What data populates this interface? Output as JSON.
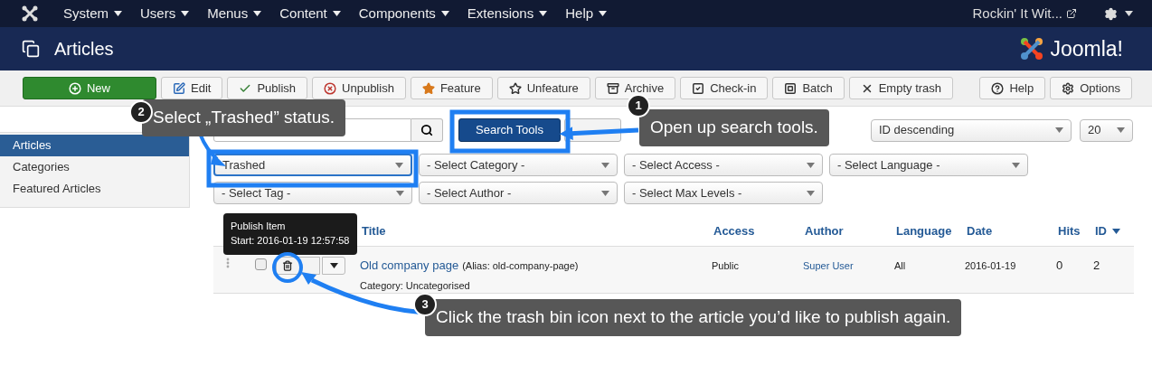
{
  "top_menu": {
    "items": [
      "System",
      "Users",
      "Menus",
      "Content",
      "Components",
      "Extensions",
      "Help"
    ],
    "site_link": "Rockin' It Wit..."
  },
  "header": {
    "title": "Articles",
    "logo_text": "Joomla!"
  },
  "toolbar": {
    "buttons": [
      {
        "label": "New",
        "kind": "new"
      },
      {
        "label": "Edit",
        "kind": "edit"
      },
      {
        "label": "Publish",
        "kind": "publish"
      },
      {
        "label": "Unpublish",
        "kind": "unpublish"
      },
      {
        "label": "Feature",
        "kind": "feature"
      },
      {
        "label": "Unfeature",
        "kind": "unfeature"
      },
      {
        "label": "Archive",
        "kind": "archive"
      },
      {
        "label": "Check-in",
        "kind": "checkin"
      },
      {
        "label": "Batch",
        "kind": "batch"
      },
      {
        "label": "Empty trash",
        "kind": "trash"
      }
    ],
    "right_buttons": [
      {
        "label": "Help",
        "kind": "help"
      },
      {
        "label": "Options",
        "kind": "options"
      }
    ]
  },
  "sidebar": {
    "items": [
      {
        "label": "Articles",
        "selected": true
      },
      {
        "label": "Categories",
        "selected": false
      },
      {
        "label": "Featured Articles",
        "selected": false
      }
    ]
  },
  "search": {
    "search_tools": "Search Tools",
    "ordering": "ID descending",
    "limit": "20"
  },
  "filters": [
    {
      "value": "Trashed",
      "focused": true
    },
    {
      "value": "- Select Category -",
      "focused": false
    },
    {
      "value": "- Select Access -",
      "focused": false
    },
    {
      "value": "- Select Language -",
      "focused": false
    },
    {
      "value": "- Select Tag -",
      "focused": false
    },
    {
      "value": "- Select Author -",
      "focused": false
    },
    {
      "value": "- Select Max Levels -",
      "focused": false
    }
  ],
  "table": {
    "columns": [
      {
        "label": "Title",
        "sorted": false
      },
      {
        "label": "Access",
        "sorted": false
      },
      {
        "label": "Author",
        "sorted": false
      },
      {
        "label": "Language",
        "sorted": false
      },
      {
        "label": "Date",
        "sorted": false
      },
      {
        "label": "Hits",
        "sorted": false
      },
      {
        "label": "ID",
        "sorted": true
      }
    ],
    "rows": [
      {
        "checked": false,
        "title": "Old company page",
        "alias": "(Alias: old-company-page)",
        "category": "Category: Uncategorised",
        "access": "Public",
        "author": "Super User",
        "language": "All",
        "date": "2016-01-19",
        "hits": "0",
        "id": "2"
      }
    ]
  },
  "tooltip": {
    "title": "Publish Item",
    "detail": "Start: 2016-01-19 12:57:58"
  },
  "annotations": [
    {
      "number": "2",
      "text": "Select „Trashed” status."
    },
    {
      "number": "1",
      "text": "Open up search tools."
    },
    {
      "number": "3",
      "text": "Click the trash bin icon next to the article you’d like to publish again."
    }
  ]
}
